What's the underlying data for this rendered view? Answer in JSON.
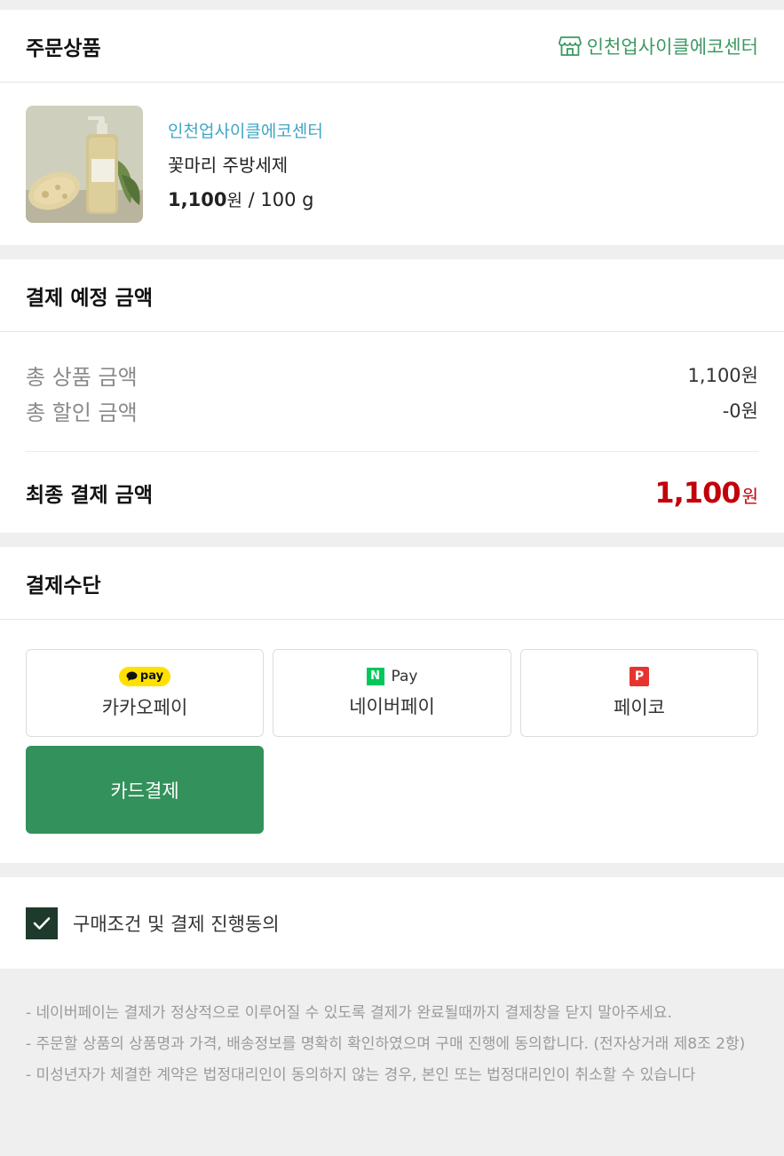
{
  "order_section": {
    "title": "주문상품",
    "store_name": "인천업사이클에코센터"
  },
  "product": {
    "store": "인천업사이클에코센터",
    "name": "꽃마리 주방세제",
    "price": "1,100",
    "price_unit": "원",
    "per": " / 100 g"
  },
  "payment_amount": {
    "title": "결제 예정 금액",
    "rows": [
      {
        "label": "총 상품 금액",
        "value": "1,100원"
      },
      {
        "label": "총 할인 금액",
        "value": "-0원"
      }
    ],
    "final_label": "최종 결제 금액",
    "final_value": "1,100",
    "final_unit": "원"
  },
  "payment_methods": {
    "title": "결제수단",
    "kakao": {
      "badge": "pay",
      "label": "카카오페이"
    },
    "naver": {
      "badge_letter": "N",
      "badge_text": "Pay",
      "label": "네이버페이"
    },
    "payco": {
      "badge_letter": "P",
      "label": "페이코"
    },
    "card": {
      "label": "카드결제"
    }
  },
  "agreement": {
    "checked": true,
    "label": "구매조건 및 결제 진행동의"
  },
  "notices": [
    "- 네이버페이는 결제가 정상적으로 이루어질 수 있도록 결제가 완료될때까지 결제창을 닫지 말아주세요.",
    "- 주문할 상품의 상품명과 가격, 배송정보를 명확히 확인하였으며 구매 진행에 동의합니다. (전자상거래 제8조 2항)",
    "- 미성년자가 체결한 계약은 법정대리인이 동의하지 않는 경우, 본인 또는 법정대리인이 취소할 수 있습니다"
  ],
  "colors": {
    "accent_green": "#33915b",
    "store_green": "#3c9a62",
    "store_blue": "#3fa6c8",
    "final_red": "#c3000a"
  }
}
